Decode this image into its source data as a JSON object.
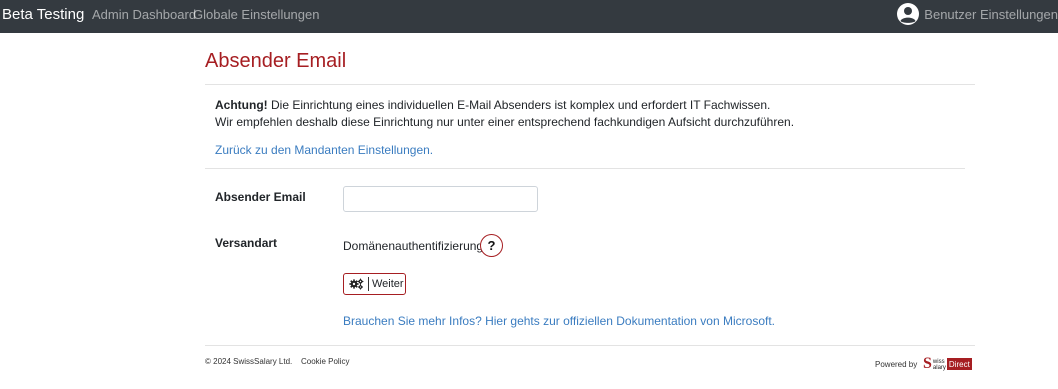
{
  "navbar": {
    "brand": "Beta Testing",
    "links": [
      "Admin Dashboard",
      "Globale Einstellungen"
    ],
    "user_icon": "user-icon",
    "user_label": "Benutzer Einstellungen"
  },
  "page": {
    "title": "Absender Email",
    "warning_strong": "Achtung!",
    "warning_line1": " Die Einrichtung eines individuellen E-Mail Absenders ist komplex und erfordert IT Fachwissen.",
    "warning_line2": "Wir empfehlen deshalb diese Einrichtung nur unter einer entsprechend fachkundigen Aufsicht durchzuführen.",
    "back_link": "Zurück zu den Mandanten Einstellungen."
  },
  "form": {
    "email_label": "Absender Email",
    "email_value": "",
    "versand_label": "Versandart",
    "versand_value": "Domänenauthentifizierung",
    "help_label": "?",
    "next_icon": "gears-icon",
    "next_label": "Weiter",
    "doc_link": "Brauchen Sie mehr Infos? Hier gehts zur offiziellen Dokumentation von Microsoft."
  },
  "footer": {
    "copyright": "© 2024 SwissSalary Ltd.",
    "cookie": "Cookie Policy",
    "powered_by": "Powered by",
    "logo_s": "S",
    "logo_top": "wiss",
    "logo_bottom": "alary",
    "logo_direct": "Direct"
  },
  "colors": {
    "navbar": "#343a40",
    "accent": "#a61e22",
    "link": "#3a7cc0"
  }
}
